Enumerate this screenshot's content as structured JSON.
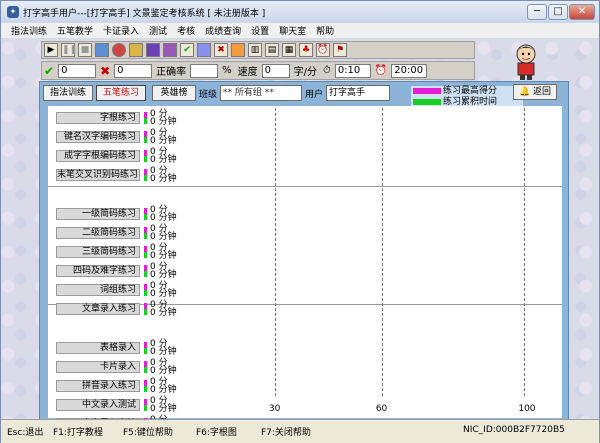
{
  "titlebar": {
    "title": "打字高手用户---[打字高手]    文景鉴定考核系统 [ 未注册版本 ]",
    "min": "─",
    "max": "□",
    "close": "✕"
  },
  "menu": [
    "指法训练",
    "五笔教学",
    "卡证录入",
    "测试",
    "考核",
    "成绩查询",
    "设置",
    "聊天室",
    "帮助"
  ],
  "icons": {
    "play": "play-icon",
    "pause": "pause-icon",
    "stop": "stop-icon"
  },
  "stats": {
    "correct": "0",
    "wrong": "0",
    "accuracy_label": "正确率",
    "accuracy_unit": "%",
    "speed_label": "速度",
    "speed": "0",
    "speed_unit": "字/分",
    "elapsed": "0:10",
    "limit": "20:00"
  },
  "controls": {
    "b1": "指法训练",
    "b2": "五笔练习",
    "b3": "英雄榜",
    "class_label": "班级",
    "class_value": "** 所有组 **",
    "user_label": "用户",
    "user_value": "打字高手",
    "back": "返回"
  },
  "legend": {
    "best": "练习最高得分",
    "time": "练习累积时间",
    "best_color": "#e71bd6",
    "time_color": "#15d120"
  },
  "chart_data": {
    "type": "bar",
    "categories": [
      "字根练习",
      "键名汉字编码练习",
      "成字字根编码练习",
      "末笔交叉识别码练习",
      "一级简码练习",
      "二级简码练习",
      "三级简码练习",
      "四码及难字练习",
      "词组练习",
      "文章录入练习",
      "表格录入",
      "卡片录入",
      "拼音录入练习",
      "中文录入测试",
      "中文录入考核"
    ],
    "series": [
      {
        "name": "练习最高得分",
        "values": [
          0,
          0,
          0,
          0,
          0,
          0,
          0,
          0,
          0,
          0,
          0,
          0,
          0,
          0,
          0
        ]
      },
      {
        "name": "练习累积时间",
        "values": [
          0,
          0,
          0,
          0,
          0,
          0,
          0,
          0,
          0,
          0,
          0,
          0,
          0,
          0,
          0
        ]
      }
    ],
    "score_label": "0 分",
    "time_label": "0 分钟",
    "xticks": [
      "30",
      "60",
      "100"
    ],
    "xlim": [
      0,
      110
    ],
    "groups": [
      4,
      6,
      5
    ]
  },
  "status": {
    "s1": "Esc:退出",
    "s2": "F1:打字教程",
    "s3": "F5:键位帮助",
    "s4": "F6:字根图",
    "s5": "F7:关闭帮助",
    "nic": "NIC_ID:000B2F7720B5"
  }
}
